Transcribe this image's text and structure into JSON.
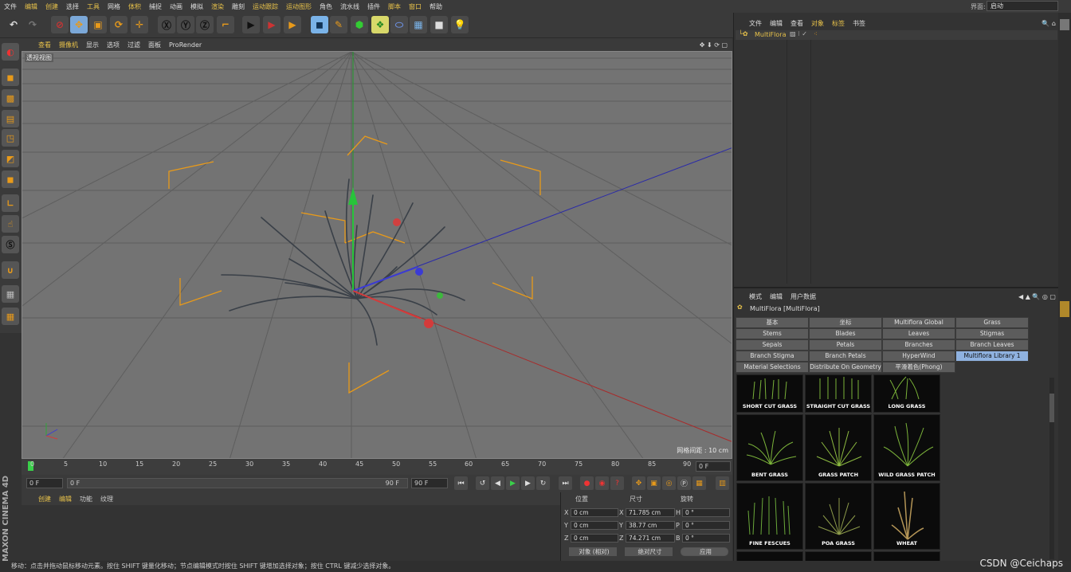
{
  "menubar": {
    "items": [
      "文件",
      "编辑",
      "创建",
      "选择",
      "工具",
      "网格",
      "体积",
      "捕捉",
      "动画",
      "模拟",
      "渲染",
      "雕刻",
      "运动跟踪",
      "运动图形",
      "角色",
      "流水线",
      "插件",
      "脚本",
      "窗口",
      "帮助"
    ],
    "layout_label": "界面:",
    "layout_value": "启动"
  },
  "viewport": {
    "menus": [
      "查看",
      "摄像机",
      "显示",
      "选项",
      "过滤",
      "面板",
      "ProRender"
    ],
    "label": "透视视图",
    "grid_readout": "网格间距 : 10 cm"
  },
  "timeline": {
    "ticks": [
      "0",
      "5",
      "10",
      "15",
      "20",
      "25",
      "30",
      "35",
      "40",
      "45",
      "50",
      "55",
      "60",
      "65",
      "70",
      "75",
      "80",
      "85",
      "90"
    ],
    "current_frame": "0 F"
  },
  "transport": {
    "start": "0 F",
    "range_start": "0 F",
    "range_end": "90 F",
    "end": "90 F"
  },
  "material_panel": {
    "menus": [
      "创建",
      "编辑",
      "功能",
      "纹理"
    ]
  },
  "coord_panel": {
    "headers": {
      "position": "位置",
      "size": "尺寸",
      "rotation": "旋转"
    },
    "rows": [
      {
        "axis": "X",
        "pos": "0 cm",
        "size_axis": "X",
        "size": "71.785 cm",
        "rot_axis": "H",
        "rot": "0 °"
      },
      {
        "axis": "Y",
        "pos": "0 cm",
        "size_axis": "Y",
        "size": "38.77 cm",
        "rot_axis": "P",
        "rot": "0 °"
      },
      {
        "axis": "Z",
        "pos": "0 cm",
        "size_axis": "Z",
        "size": "74.271 cm",
        "rot_axis": "B",
        "rot": "0 °"
      }
    ],
    "mode_select": "对象 (相对)",
    "size_select": "绝对尺寸",
    "apply_button": "应用"
  },
  "status": "移动：点击并拖动鼠标移动元素。按住 SHIFT 键量化移动；节点编辑模式时按住 SHIFT 键增加选择对象；按住 CTRL 键减少选择对象。",
  "object_manager": {
    "menus": [
      "文件",
      "编辑",
      "查看",
      "对象",
      "标签",
      "书签"
    ],
    "object_name": "MultiFlora"
  },
  "attributes": {
    "menus": [
      "模式",
      "编辑",
      "用户数据"
    ],
    "title": "MultiFlora [MultiFlora]",
    "tabs": [
      [
        "基本",
        "坐标",
        "Multiflora Global",
        "Grass"
      ],
      [
        "Stems",
        "Blades",
        "Leaves",
        "Stigmas"
      ],
      [
        "Sepals",
        "Petals",
        "Branches",
        "Branch Leaves"
      ],
      [
        "Branch Stigma",
        "Branch Petals",
        "HyperWind",
        "Multiflora Library 1"
      ],
      [
        "Material Selections",
        "Distribute On Geometry",
        "平滑着色(Phong)"
      ]
    ],
    "tiles": [
      "SHORT CUT GRASS",
      "STRAIGHT CUT GRASS",
      "LONG GRASS",
      "BENT GRASS",
      "GRASS PATCH",
      "WILD GRASS PATCH",
      "FINE FESCUES",
      "POA GRASS",
      "WHEAT"
    ]
  },
  "brand": "MAXON CINEMA 4D",
  "watermark": "CSDN @Ceichaps"
}
